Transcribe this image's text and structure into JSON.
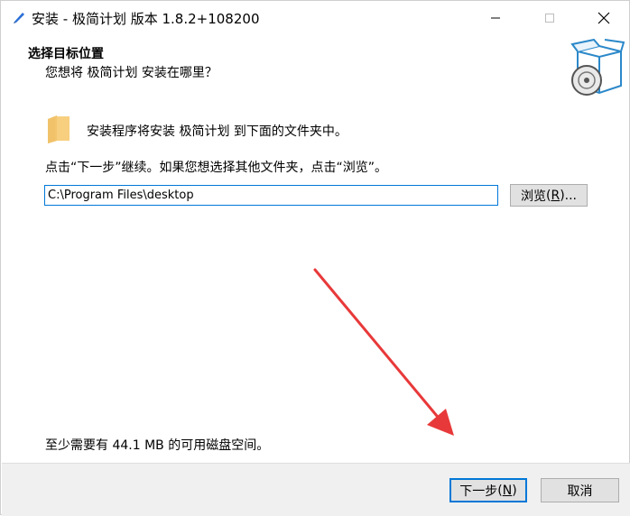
{
  "window": {
    "title": "安装 - 极简计划 版本 1.8.2+108200",
    "icon": "pen-icon"
  },
  "header": {
    "title": "选择目标位置",
    "subtitle": "您想将 极简计划 安装在哪里？",
    "icon": "install-box-cd-icon"
  },
  "content": {
    "info": "安装程序将安装 极简计划 到下面的文件夹中。",
    "hint": "点击“下一步”继续。如果您想选择其他文件夹，点击“浏览”。",
    "path_value": "C:\\Program Files\\desktop",
    "browse_label": "浏览",
    "browse_key": "R",
    "space": "至少需要有 44.1 MB 的可用磁盘空间。"
  },
  "footer": {
    "next_label": "下一步",
    "next_key": "N",
    "cancel_label": "取消"
  },
  "colors": {
    "accent": "#0078d7",
    "arrow": "#e8393a",
    "footer_bg": "#f0f0f0",
    "button_bg": "#e1e1e1"
  }
}
